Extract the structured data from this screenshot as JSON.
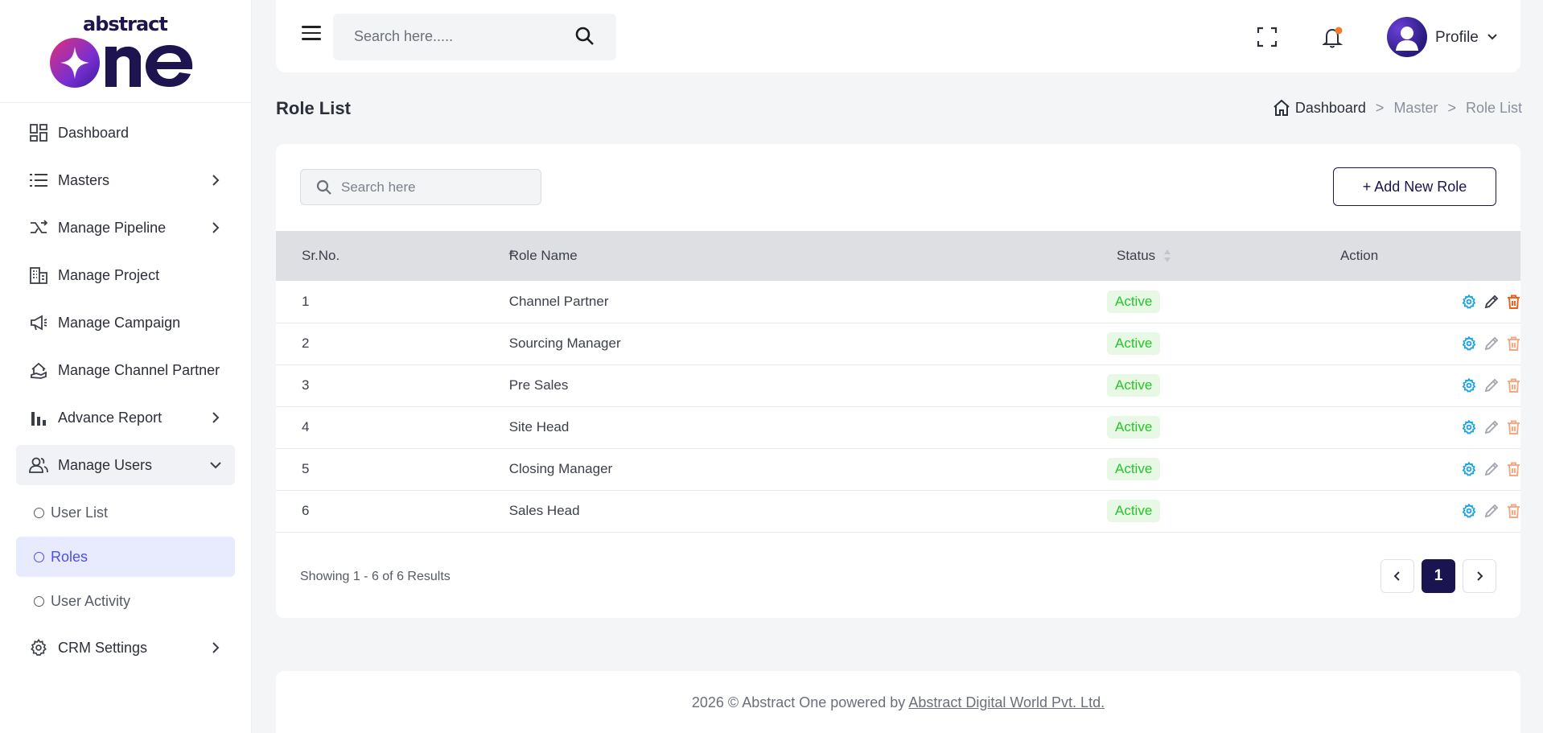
{
  "brand": {
    "logo_top": "abstract",
    "logo_main": "One"
  },
  "sidebar": {
    "items": [
      {
        "label": "Dashboard"
      },
      {
        "label": "Masters"
      },
      {
        "label": "Manage Pipeline"
      },
      {
        "label": "Manage Project"
      },
      {
        "label": "Manage Campaign"
      },
      {
        "label": "Manage Channel Partner"
      },
      {
        "label": "Advance Report"
      },
      {
        "label": "Manage Users"
      },
      {
        "label": "CRM Settings"
      }
    ],
    "subitems": [
      {
        "label": "User List"
      },
      {
        "label": "Roles"
      },
      {
        "label": "User Activity"
      }
    ]
  },
  "header": {
    "search_placeholder": "Search here.....",
    "profile_label": "Profile"
  },
  "page": {
    "title": "Role List",
    "breadcrumb": [
      "Dashboard",
      "Master",
      "Role List"
    ],
    "breadcrumb_sep": ">"
  },
  "toolbar": {
    "search_placeholder": "Search here",
    "add_label": "+ Add New Role"
  },
  "table": {
    "columns": [
      "Sr.No.",
      "Role Name",
      "Status",
      "Action"
    ],
    "rows": [
      {
        "sr": "1",
        "name": "Channel Partner",
        "status": "Active"
      },
      {
        "sr": "2",
        "name": "Sourcing Manager",
        "status": "Active"
      },
      {
        "sr": "3",
        "name": "Pre Sales",
        "status": "Active"
      },
      {
        "sr": "4",
        "name": "Site Head",
        "status": "Active"
      },
      {
        "sr": "5",
        "name": "Closing Manager",
        "status": "Active"
      },
      {
        "sr": "6",
        "name": "Sales Head",
        "status": "Active"
      }
    ]
  },
  "pagination": {
    "summary": "Showing 1 - 6 of 6 Results",
    "current_page": "1"
  },
  "footer": {
    "text": "2026 © Abstract One powered by",
    "link": "Abstract Digital World Pvt. Ltd."
  },
  "colors": {
    "brand_navy": "#1a1450",
    "active_accent": "#4c4ee8",
    "status_green": "#27c42a",
    "settings_icon": "#1aa3e8",
    "delete_icon": "#f25a16"
  }
}
